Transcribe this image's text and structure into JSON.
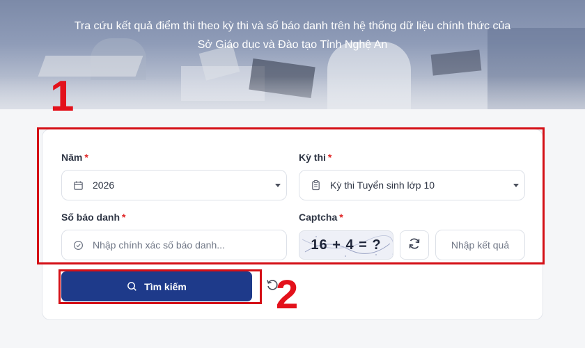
{
  "header": {
    "subtitle_line1": "Tra cứu kết quả điểm thi theo kỳ thi và số báo danh trên hệ thống dữ liệu chính thức của",
    "subtitle_line2": "Sở Giáo dục và Đào tạo Tỉnh Nghệ An"
  },
  "annotations": {
    "step1": "1",
    "step2": "2"
  },
  "form": {
    "year": {
      "label": "Năm",
      "required_mark": "*",
      "value": "2026",
      "icon": "calendar-icon"
    },
    "exam": {
      "label": "Kỳ thi",
      "required_mark": "*",
      "value": "Kỳ thi Tuyển sinh lớp 10",
      "icon": "clipboard-icon"
    },
    "candidate_number": {
      "label": "Số báo danh",
      "required_mark": "*",
      "placeholder": "Nhập chính xác số báo danh...",
      "icon": "check-circle-icon"
    },
    "captcha": {
      "label": "Captcha",
      "required_mark": "*",
      "challenge": "16 + 4 = ?",
      "answer_placeholder": "Nhập kết quả",
      "refresh_icon": "refresh-icon"
    }
  },
  "actions": {
    "search_label": "Tìm kiếm",
    "search_icon": "search-icon",
    "reset_icon": "reset-icon"
  },
  "colors": {
    "primary": "#1e3a8a",
    "annotation": "#e3111b",
    "required": "#e02424"
  }
}
